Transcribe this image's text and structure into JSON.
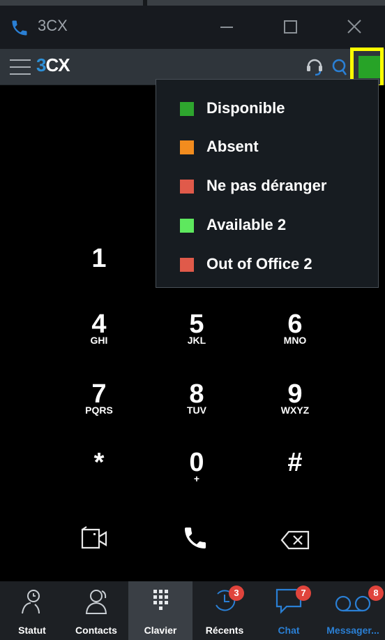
{
  "window": {
    "title": "3CX"
  },
  "appbar": {
    "logo_three": "3",
    "logo_cx": "CX"
  },
  "status_menu": {
    "items": [
      {
        "label": "Disponible",
        "color": "#2ea52e"
      },
      {
        "label": "Absent",
        "color": "#f28c1e"
      },
      {
        "label": "Ne pas déranger",
        "color": "#e05a4a"
      },
      {
        "label": "Available 2",
        "color": "#5ee85e"
      },
      {
        "label": "Out of Office 2",
        "color": "#e05a4a"
      }
    ]
  },
  "current_status_color": "#27a327",
  "keypad": {
    "keys": [
      {
        "digit": "1",
        "letters": ""
      },
      {
        "digit": "4",
        "letters": "GHI"
      },
      {
        "digit": "5",
        "letters": "JKL"
      },
      {
        "digit": "6",
        "letters": "MNO"
      },
      {
        "digit": "7",
        "letters": "PQRS"
      },
      {
        "digit": "8",
        "letters": "TUV"
      },
      {
        "digit": "9",
        "letters": "WXYZ"
      },
      {
        "digit": "*",
        "letters": ""
      },
      {
        "digit": "0",
        "letters": "+"
      },
      {
        "digit": "#",
        "letters": ""
      }
    ]
  },
  "bottom_nav": {
    "items": [
      {
        "label": "Statut",
        "icon": "status-icon"
      },
      {
        "label": "Contacts",
        "icon": "contacts-icon"
      },
      {
        "label": "Clavier",
        "icon": "dialpad-icon"
      },
      {
        "label": "Récents",
        "icon": "recents-icon",
        "badge": "3"
      },
      {
        "label": "Chat",
        "icon": "chat-icon",
        "badge": "7"
      },
      {
        "label": "Messager...",
        "icon": "voicemail-icon",
        "badge": "8"
      }
    ]
  },
  "colors": {
    "accent_blue": "#2a7fd4",
    "badge_red": "#e0443c",
    "highlight": "#ffff00"
  }
}
